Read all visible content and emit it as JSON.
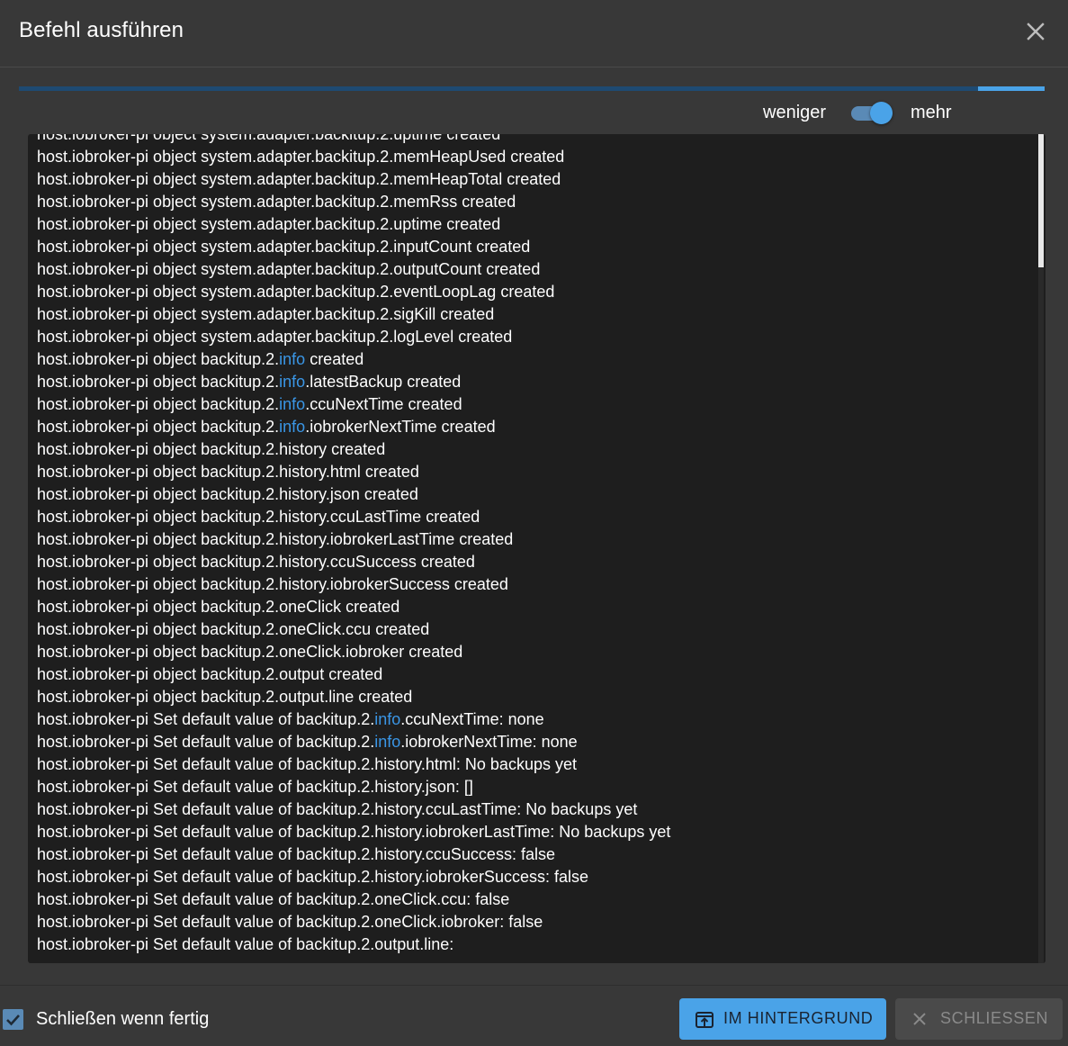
{
  "dialog": {
    "title": "Befehl ausführen",
    "progress_percent": 94
  },
  "toggle": {
    "less_label": "weniger",
    "more_label": "mehr",
    "state": "mehr"
  },
  "log": {
    "lines": [
      [
        "host.iobroker-pi object system.adapter.backitup.2.uptime created"
      ],
      [
        "host.iobroker-pi object system.adapter.backitup.2.memHeapUsed created"
      ],
      [
        "host.iobroker-pi object system.adapter.backitup.2.memHeapTotal created"
      ],
      [
        "host.iobroker-pi object system.adapter.backitup.2.memRss created"
      ],
      [
        "host.iobroker-pi object system.adapter.backitup.2.uptime created"
      ],
      [
        "host.iobroker-pi object system.adapter.backitup.2.inputCount created"
      ],
      [
        "host.iobroker-pi object system.adapter.backitup.2.outputCount created"
      ],
      [
        "host.iobroker-pi object system.adapter.backitup.2.eventLoopLag created"
      ],
      [
        "host.iobroker-pi object system.adapter.backitup.2.sigKill created"
      ],
      [
        "host.iobroker-pi object system.adapter.backitup.2.logLevel created"
      ],
      [
        "host.iobroker-pi object backitup.2.",
        "info",
        " created"
      ],
      [
        "host.iobroker-pi object backitup.2.",
        "info",
        ".latestBackup created"
      ],
      [
        "host.iobroker-pi object backitup.2.",
        "info",
        ".ccuNextTime created"
      ],
      [
        "host.iobroker-pi object backitup.2.",
        "info",
        ".iobrokerNextTime created"
      ],
      [
        "host.iobroker-pi object backitup.2.history created"
      ],
      [
        "host.iobroker-pi object backitup.2.history.html created"
      ],
      [
        "host.iobroker-pi object backitup.2.history.json created"
      ],
      [
        "host.iobroker-pi object backitup.2.history.ccuLastTime created"
      ],
      [
        "host.iobroker-pi object backitup.2.history.iobrokerLastTime created"
      ],
      [
        "host.iobroker-pi object backitup.2.history.ccuSuccess created"
      ],
      [
        "host.iobroker-pi object backitup.2.history.iobrokerSuccess created"
      ],
      [
        "host.iobroker-pi object backitup.2.oneClick created"
      ],
      [
        "host.iobroker-pi object backitup.2.oneClick.ccu created"
      ],
      [
        "host.iobroker-pi object backitup.2.oneClick.iobroker created"
      ],
      [
        "host.iobroker-pi object backitup.2.output created"
      ],
      [
        "host.iobroker-pi object backitup.2.output.line created"
      ],
      [
        "host.iobroker-pi Set default value of backitup.2.",
        "info",
        ".ccuNextTime: none"
      ],
      [
        "host.iobroker-pi Set default value of backitup.2.",
        "info",
        ".iobrokerNextTime: none"
      ],
      [
        "host.iobroker-pi Set default value of backitup.2.history.html: No backups yet"
      ],
      [
        "host.iobroker-pi Set default value of backitup.2.history.json: []"
      ],
      [
        "host.iobroker-pi Set default value of backitup.2.history.ccuLastTime: No backups yet"
      ],
      [
        "host.iobroker-pi Set default value of backitup.2.history.iobrokerLastTime: No backups yet"
      ],
      [
        "host.iobroker-pi Set default value of backitup.2.history.ccuSuccess: false"
      ],
      [
        "host.iobroker-pi Set default value of backitup.2.history.iobrokerSuccess: false"
      ],
      [
        "host.iobroker-pi Set default value of backitup.2.oneClick.ccu: false"
      ],
      [
        "host.iobroker-pi Set default value of backitup.2.oneClick.iobroker: false"
      ],
      [
        "host.iobroker-pi Set default value of backitup.2.output.line:"
      ]
    ],
    "highlight_color": "#3a96e6"
  },
  "footer": {
    "checkbox_label": "Schließen wenn fertig",
    "checkbox_checked": true,
    "background_button_label": "IM HINTERGRUND",
    "close_button_label": "SCHLIESSEN"
  },
  "colors": {
    "accent": "#4aa3e8",
    "background": "#383838",
    "log_background": "#1e1e1e"
  },
  "icons": {
    "title_close": "close-icon",
    "background_button": "open-in-background-icon",
    "close_button": "close-icon",
    "checkbox": "check-icon"
  }
}
